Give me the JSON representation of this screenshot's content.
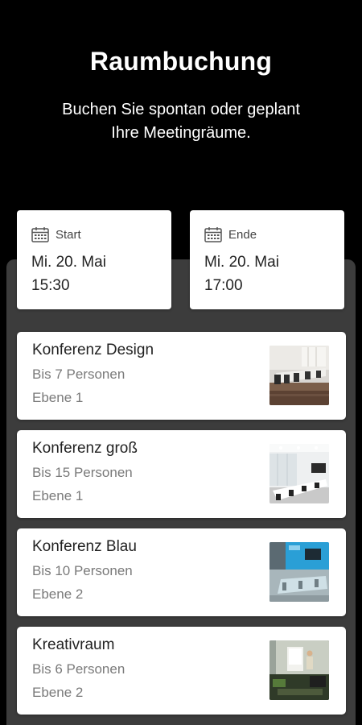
{
  "header": {
    "title": "Raumbuchung",
    "subtitle_line1": "Buchen Sie spontan oder geplant",
    "subtitle_line2": "Ihre Meetingräume."
  },
  "booking": {
    "start": {
      "label": "Start",
      "date": "Mi. 20. Mai",
      "time": "15:30",
      "icon": "calendar-icon"
    },
    "end": {
      "label": "Ende",
      "date": "Mi. 20. Mai",
      "time": "17:00",
      "icon": "calendar-icon"
    }
  },
  "rooms": [
    {
      "name": "Konferenz Design",
      "capacity": "Bis 7 Personen",
      "level": "Ebene 1"
    },
    {
      "name": "Konferenz groß",
      "capacity": "Bis 15 Personen",
      "level": "Ebene 1"
    },
    {
      "name": "Konferenz Blau",
      "capacity": "Bis 10 Personen",
      "level": "Ebene 2"
    },
    {
      "name": "Kreativraum",
      "capacity": "Bis 6 Personen",
      "level": "Ebene 2"
    }
  ],
  "colors": {
    "background": "#000000",
    "panel": "#3c3c3c",
    "card": "#ffffff",
    "secondary_text": "#7a7a7a"
  }
}
